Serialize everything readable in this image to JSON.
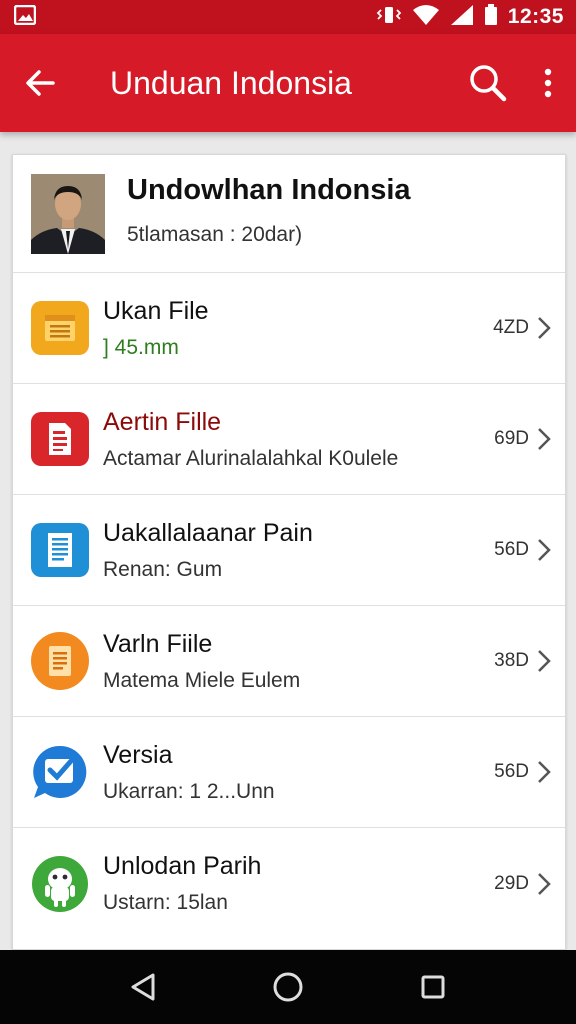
{
  "status_bar": {
    "time": "12:35"
  },
  "app_bar": {
    "title": "Unduan Indonsia"
  },
  "profile": {
    "name": "Undowlhan Indonsia",
    "subtitle": "5tlamasan : 20dar)"
  },
  "items": [
    {
      "title": "Ukan File",
      "subtitle": "] 45.mm",
      "size": "4ZD",
      "title_color": "#111111",
      "subtitle_color": "#2e7d1f",
      "icon": "document-icon",
      "icon_color": "#f2a81d"
    },
    {
      "title": "Aertin Fille",
      "subtitle": "Actamar Alurinalalahkal K0ulele",
      "size": "69D",
      "title_color": "#8b0a0a",
      "subtitle_color": "#333333",
      "icon": "pdf-document-icon",
      "icon_color": "#d9262b"
    },
    {
      "title": "Uakallalaanar Pain",
      "subtitle": "Renan: Gum",
      "size": "56D",
      "title_color": "#111111",
      "subtitle_color": "#333333",
      "icon": "word-document-icon",
      "icon_color": "#1f8fd6"
    },
    {
      "title": "Varln Fiile",
      "subtitle": "Matema Miele Eulem",
      "size": "38D",
      "title_color": "#111111",
      "subtitle_color": "#333333",
      "icon": "notes-icon",
      "icon_color": "#f28a1f"
    },
    {
      "title": "Versia",
      "subtitle": "Ukarran: 1 2...Unn",
      "size": "56D",
      "title_color": "#111111",
      "subtitle_color": "#333333",
      "icon": "chat-check-icon",
      "icon_color": "#1f7bd6"
    },
    {
      "title": "Unlodan Parih",
      "subtitle": "Ustarn: 15lan",
      "size": "29D",
      "title_color": "#111111",
      "subtitle_color": "#333333",
      "icon": "android-icon",
      "icon_color": "#3fa83a"
    }
  ],
  "colors": {
    "status_bar": "#c0111f",
    "app_bar": "#d61a27",
    "nav_bar": "#050505"
  }
}
